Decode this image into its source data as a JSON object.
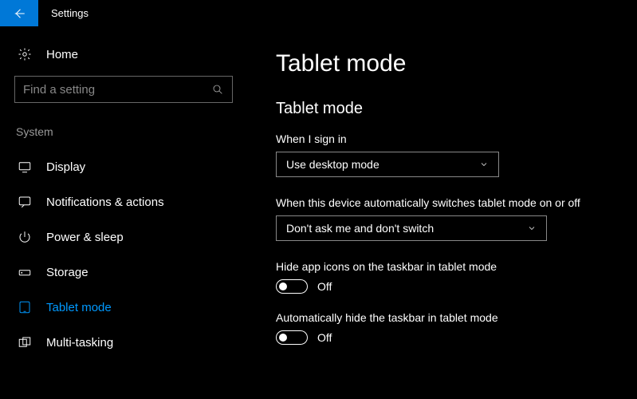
{
  "titlebar": {
    "title": "Settings"
  },
  "sidebar": {
    "home": "Home",
    "search_placeholder": "Find a setting",
    "section": "System",
    "items": [
      {
        "label": "Display"
      },
      {
        "label": "Notifications & actions"
      },
      {
        "label": "Power & sleep"
      },
      {
        "label": "Storage"
      },
      {
        "label": "Tablet mode"
      },
      {
        "label": "Multi-tasking"
      }
    ]
  },
  "content": {
    "page_title": "Tablet mode",
    "section_title": "Tablet mode",
    "signin": {
      "label": "When I sign in",
      "value": "Use desktop mode"
    },
    "autoswitch": {
      "label": "When this device automatically switches tablet mode on or off",
      "value": "Don't ask me and don't switch"
    },
    "hide_icons": {
      "label": "Hide app icons on the taskbar in tablet mode",
      "state": "Off"
    },
    "hide_taskbar": {
      "label": "Automatically hide the taskbar in tablet mode",
      "state": "Off"
    }
  }
}
